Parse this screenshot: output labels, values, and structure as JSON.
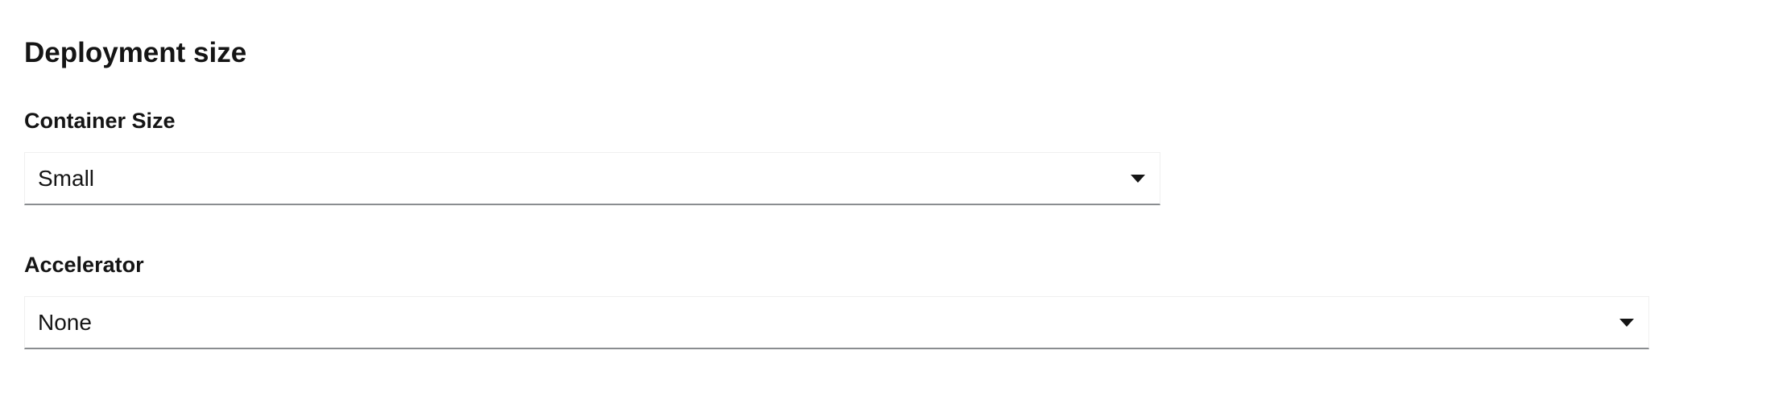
{
  "section": {
    "title": "Deployment size"
  },
  "fields": {
    "container_size": {
      "label": "Container Size",
      "value": "Small"
    },
    "accelerator": {
      "label": "Accelerator",
      "value": "None"
    }
  },
  "icons": {
    "dropdown": "caret-down-icon"
  },
  "colors": {
    "text": "#151515",
    "border_light": "#f0f0f0",
    "border_bottom": "#8a8d90",
    "background": "#ffffff"
  }
}
